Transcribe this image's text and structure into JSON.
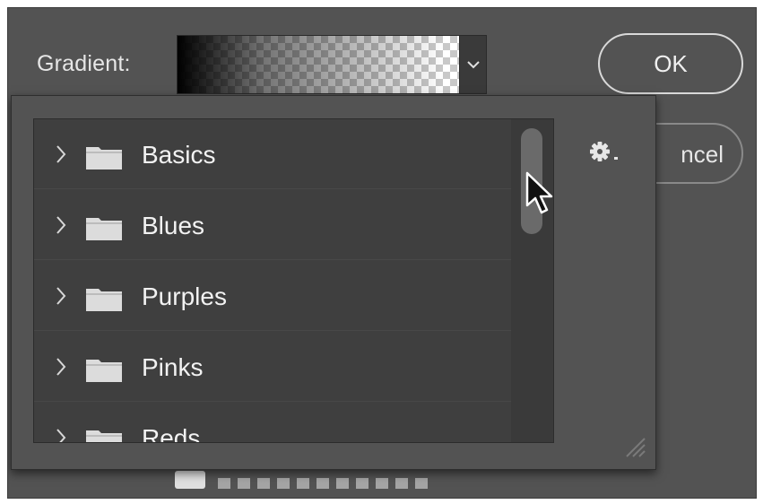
{
  "dialog": {
    "gradient_label": "Gradient:",
    "ok_label": "OK",
    "cancel_label": "ncel"
  },
  "preset_list": {
    "items": [
      {
        "label": "Basics"
      },
      {
        "label": "Blues"
      },
      {
        "label": "Purples"
      },
      {
        "label": "Pinks"
      },
      {
        "label": "Reds"
      }
    ]
  },
  "icons": {
    "dropdown": "chevron-down-icon",
    "expand": "chevron-right-icon",
    "folder": "folder-icon",
    "settings": "gear-icon",
    "resize": "resize-grip-icon",
    "cursor": "mouse-pointer-icon"
  },
  "colors": {
    "dialog_bg": "#535353",
    "list_bg": "#3f3f3f",
    "text": "#f2f2f2"
  }
}
